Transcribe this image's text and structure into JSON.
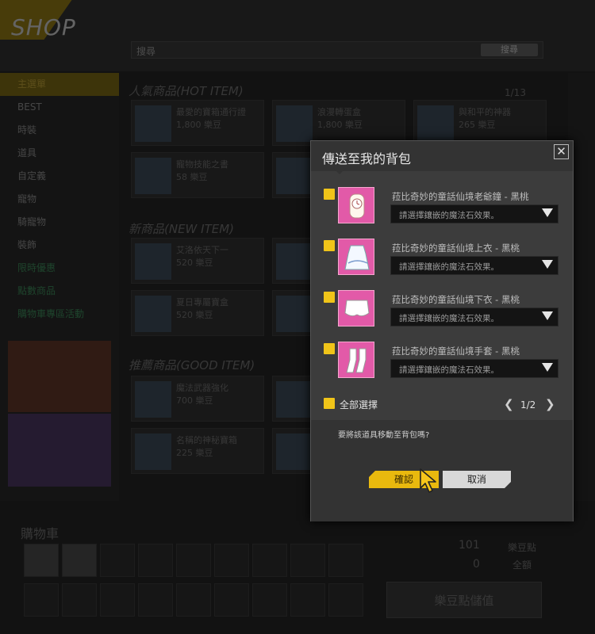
{
  "shop": {
    "title": "SHOP",
    "search_label": "搜尋",
    "search_button": "搜尋",
    "sidebar": [
      "主選單",
      "BEST",
      "時裝",
      "道具",
      "自定義",
      "寵物",
      "騎寵物",
      "裝飾",
      "限時優惠",
      "點數商品",
      "購物車專區活動"
    ],
    "sections": [
      {
        "title": "人氣商品(HOT ITEM)",
        "pager": "1/13"
      },
      {
        "title": "新商品(NEW ITEM)"
      },
      {
        "title": "推薦商品(GOOD ITEM)"
      }
    ],
    "items": [
      {
        "name": "最愛的寶箱通行證",
        "price": "1,800 樂豆"
      },
      {
        "name": "浪漫轉蛋盒",
        "price": "1,800 樂豆"
      },
      {
        "name": "與和平的神器",
        "price": "265 樂豆"
      },
      {
        "name": "寵物技能之書",
        "price": "58 樂豆"
      },
      {
        "name": "艾洛依天下一",
        "price": "520 樂豆"
      },
      {
        "name": "夏日專屬寶盒",
        "price": "520 樂豆"
      },
      {
        "name": "魔法武器強化",
        "price": "700 樂豆"
      },
      {
        "name": "名稱的神秘寶箱",
        "price": "225 樂豆"
      }
    ],
    "cart_title": "購物車",
    "cart_count": "101",
    "cart_zero": "0",
    "cart_label_points": "樂豆點",
    "cart_label_total": "全額",
    "charge_button": "樂豆點儲值"
  },
  "dialog": {
    "title": "傳送至我的背包",
    "close": "✕",
    "items": [
      {
        "name": "菈比奇妙的童話仙境老爺鐘 - 黑桃",
        "stone_placeholder": "請選擇鑲嵌的魔法石效果。",
        "icon": "clock-costume-icon",
        "checked": true
      },
      {
        "name": "菈比奇妙的童話仙境上衣 - 黑桃",
        "stone_placeholder": "請選擇鑲嵌的魔法石效果。",
        "icon": "dress-top-icon",
        "checked": true
      },
      {
        "name": "菈比奇妙的童話仙境下衣 - 黑桃",
        "stone_placeholder": "請選擇鑲嵌的魔法石效果。",
        "icon": "skirt-icon",
        "checked": true
      },
      {
        "name": "菈比奇妙的童話仙境手套 - 黑桃",
        "stone_placeholder": "請選擇鑲嵌的魔法石效果。",
        "icon": "gloves-icon",
        "checked": true
      }
    ],
    "select_all": "全部選擇",
    "page": "1/2",
    "question": "要將該道具移動至背包嗎?",
    "confirm": "確認",
    "cancel": "取消"
  },
  "colors": {
    "accent": "#e9b90e",
    "checkbox": "#f0c419",
    "item_icon_bg": "#e25aa8"
  }
}
